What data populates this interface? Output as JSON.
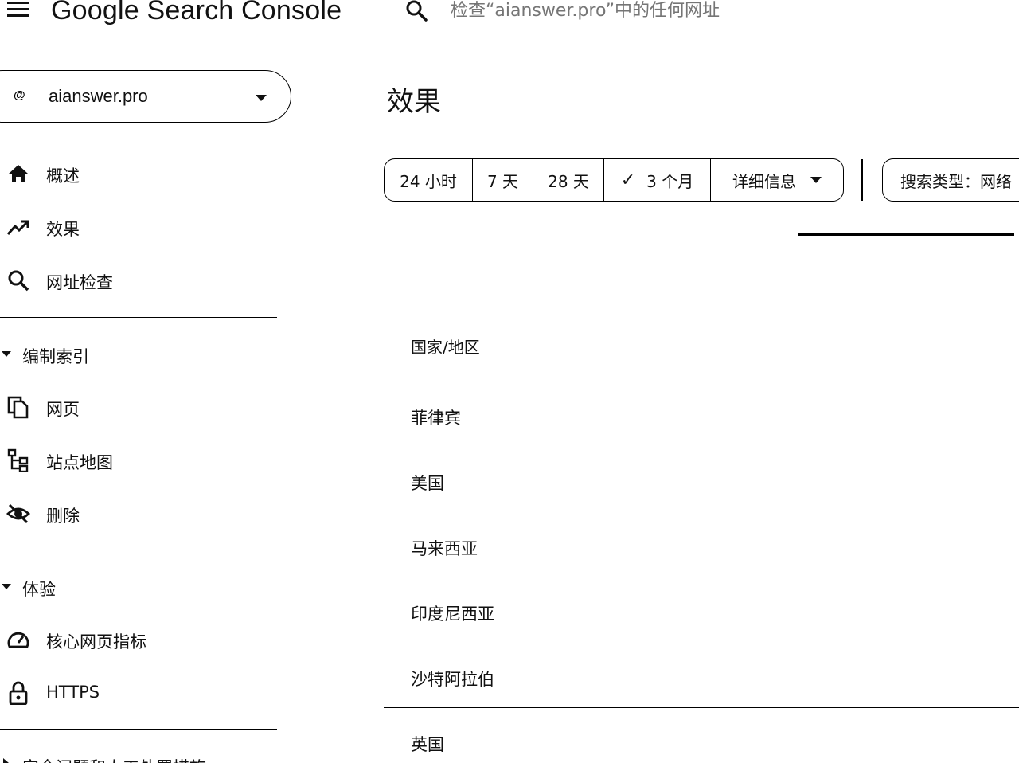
{
  "header": {
    "app_title": "Google Search Console",
    "search_placeholder": "检查“aianswer.pro”中的任何网址"
  },
  "property": {
    "name": "aianswer.pro",
    "icon_glyph": "@"
  },
  "sidebar": {
    "items": [
      {
        "label": "概述",
        "icon": "home-icon"
      },
      {
        "label": "效果",
        "icon": "trending-up-icon"
      },
      {
        "label": "网址检查",
        "icon": "search-icon"
      }
    ],
    "sections": [
      {
        "label": "编制索引",
        "items": [
          {
            "label": "网页",
            "icon": "pages-icon"
          },
          {
            "label": "站点地图",
            "icon": "sitemap-icon"
          },
          {
            "label": "删除",
            "icon": "visibility-off-icon"
          }
        ]
      },
      {
        "label": "体验",
        "items": [
          {
            "label": "核心网页指标",
            "icon": "speed-gauge-icon"
          },
          {
            "label": "HTTPS",
            "icon": "lock-icon"
          }
        ]
      },
      {
        "label": "安全问题和人工处置措施"
      }
    ]
  },
  "main": {
    "title": "效果",
    "date_ranges": [
      "24 小时",
      "7 天",
      "28 天",
      "3 个月"
    ],
    "selected_range": "3 个月",
    "more_label": "详细信息",
    "search_type_label": "搜索类型：网络",
    "table": {
      "column_header": "国家/地区",
      "rows": [
        "菲律宾",
        "美国",
        "马来西亚",
        "印度尼西亚",
        "沙特阿拉伯",
        "英国"
      ]
    }
  }
}
